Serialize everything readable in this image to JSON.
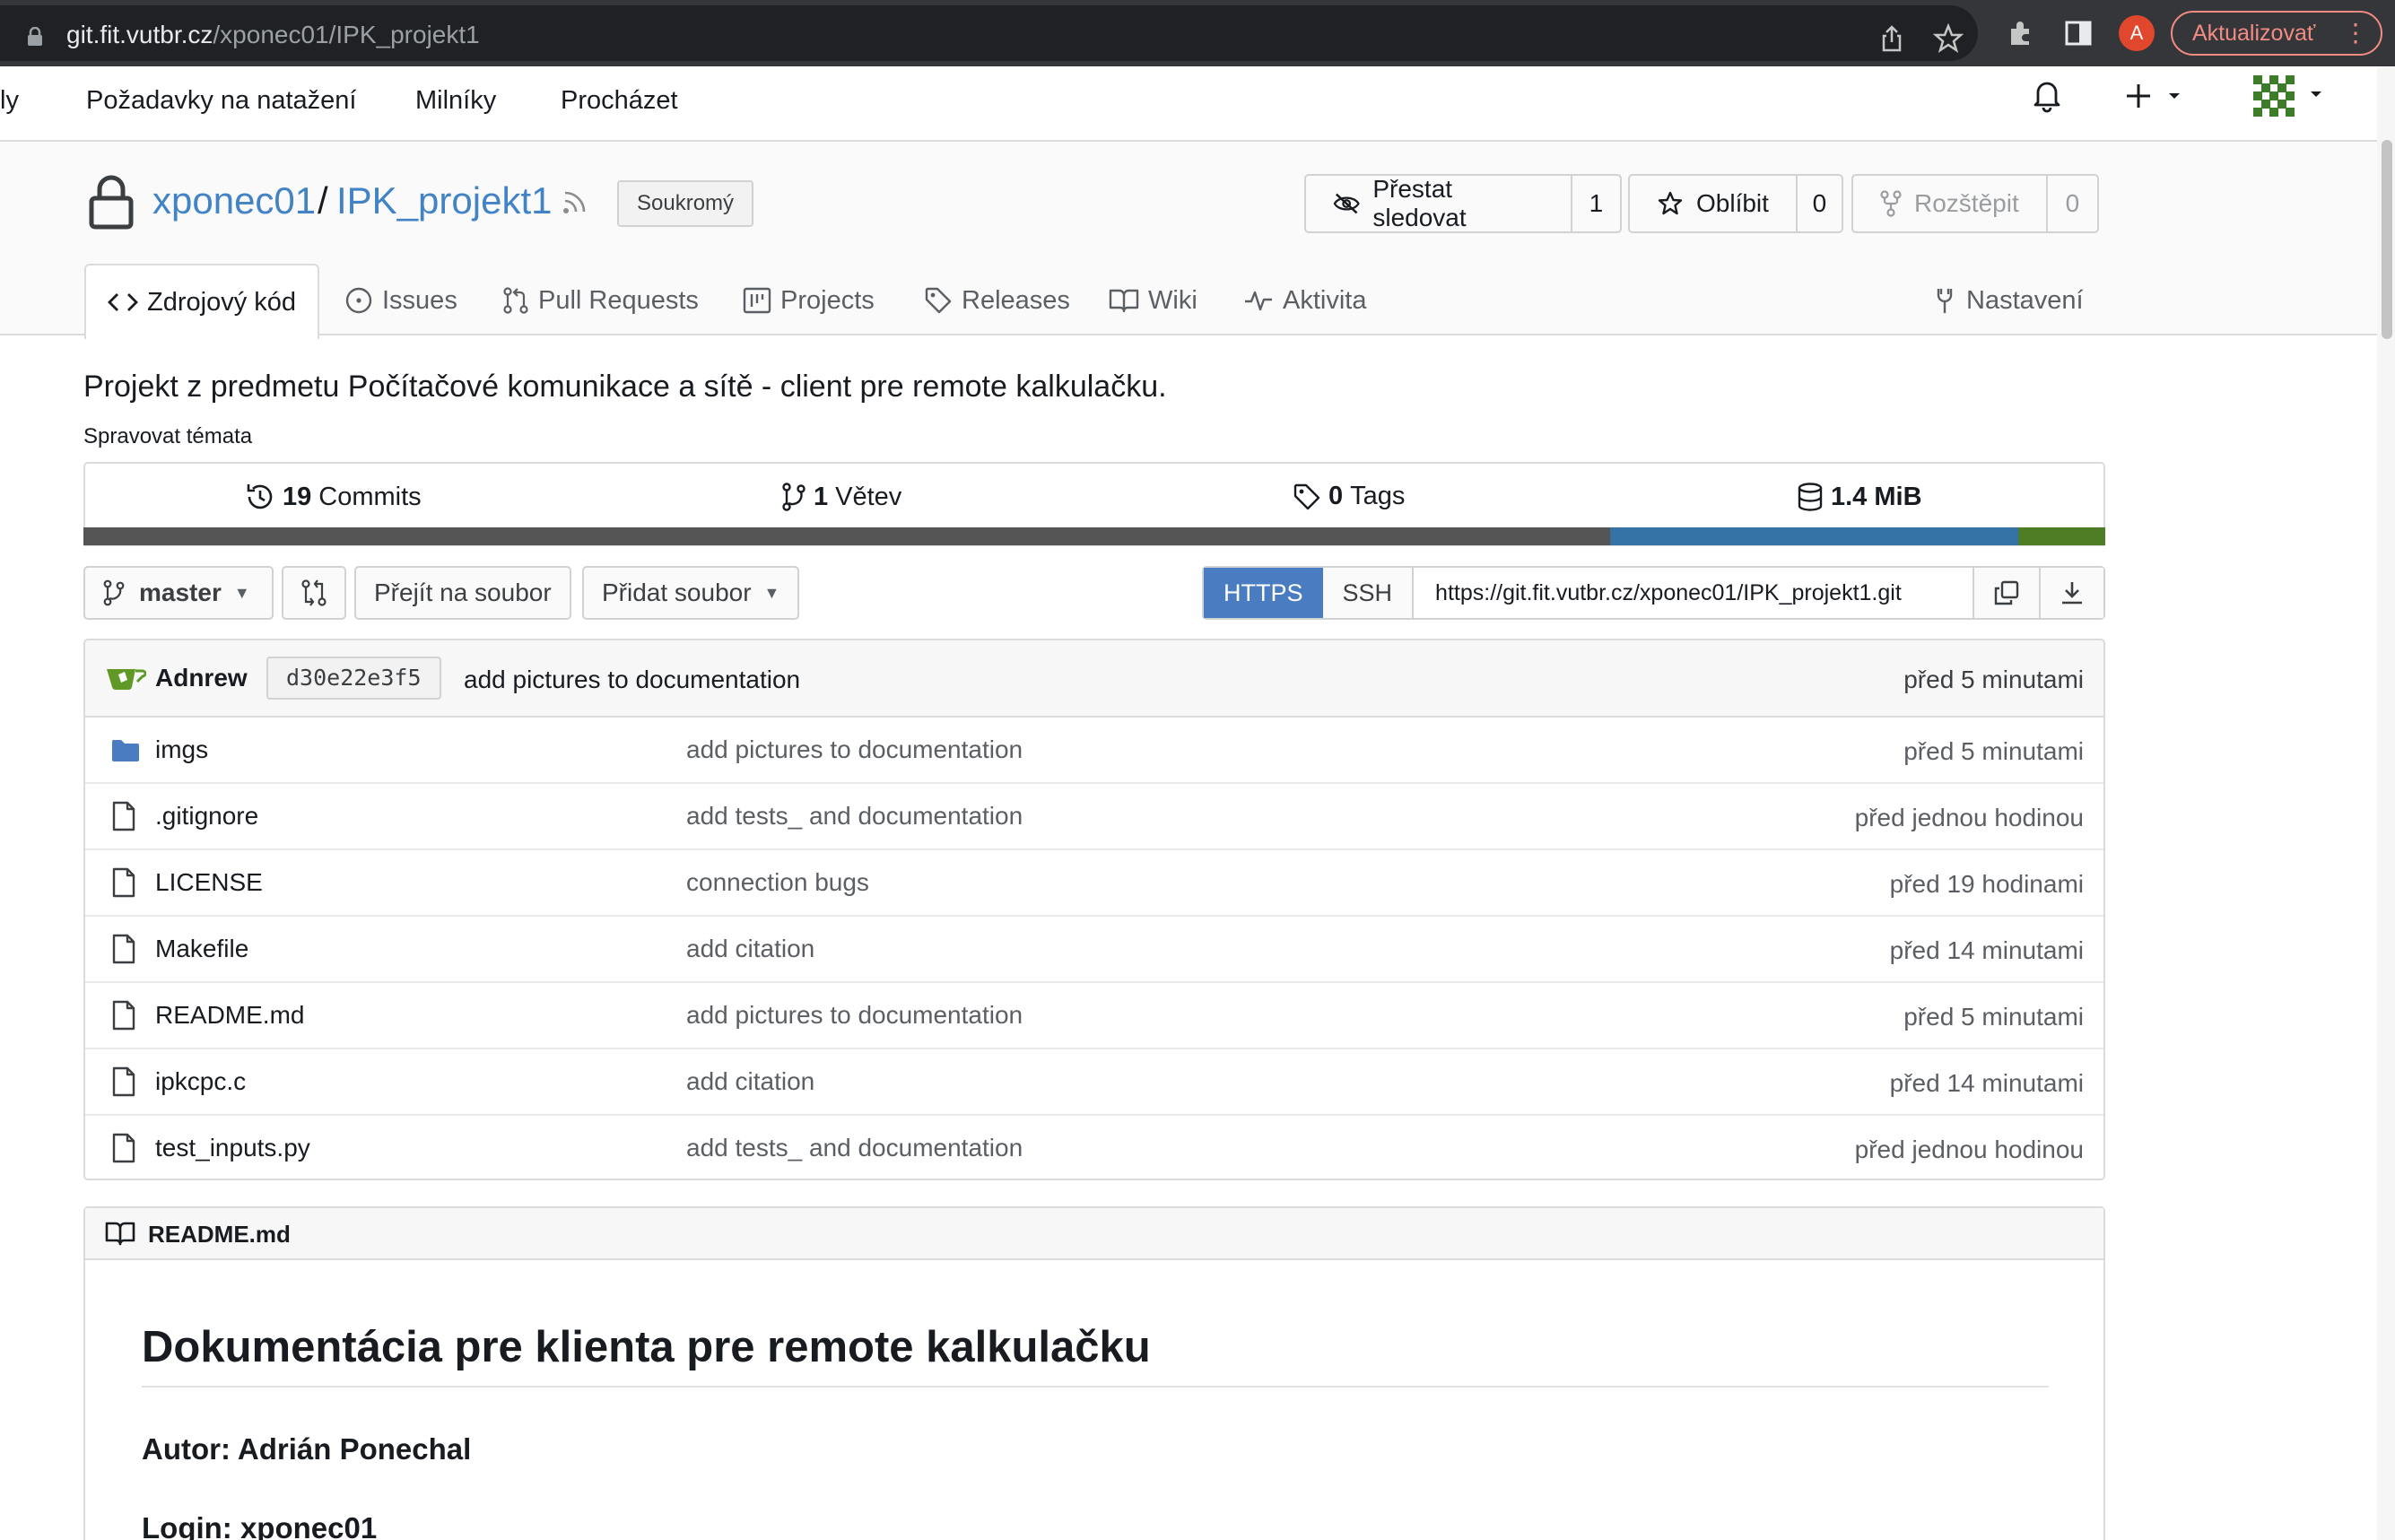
{
  "browser": {
    "url_host": "git.fit.vutbr.cz",
    "url_path": "/xponec01/IPK_projekt1",
    "avatar_letter": "A",
    "update_label": "Aktualizovať"
  },
  "topnav": {
    "items": [
      "ly",
      "Požadavky na natažení",
      "Milníky",
      "Procházet"
    ]
  },
  "repo": {
    "owner": "xponec01",
    "separator": "/",
    "name": "IPK_projekt1",
    "visibility": "Soukromý",
    "watch_label": "Přestat sledovat",
    "watch_count": "1",
    "star_label": "Oblíbit",
    "star_count": "0",
    "fork_label": "Rozštěpit",
    "fork_count": "0"
  },
  "tabs": [
    {
      "label": "Zdrojový kód",
      "icon": "code-icon"
    },
    {
      "label": "Issues",
      "icon": "issue-icon"
    },
    {
      "label": "Pull Requests",
      "icon": "pull-request-icon"
    },
    {
      "label": "Projects",
      "icon": "project-icon"
    },
    {
      "label": "Releases",
      "icon": "tag-icon"
    },
    {
      "label": "Wiki",
      "icon": "book-icon"
    },
    {
      "label": "Aktivita",
      "icon": "pulse-icon"
    },
    {
      "label": "Nastavení",
      "icon": "tools-icon"
    }
  ],
  "description": "Projekt z predmetu Počítačové komunikace a sítě - client pre remote kalkulačku.",
  "manage_topics": "Spravovat témata",
  "stats": {
    "commits_count": "19",
    "commits_label": "Commits",
    "branches_count": "1",
    "branches_label": "Větev",
    "tags_count": "0",
    "tags_label": "Tags",
    "size": "1.4 MiB"
  },
  "languages": [
    {
      "fraction": 0.755,
      "color": "#555555"
    },
    {
      "fraction": 0.202,
      "color": "#3572a5"
    },
    {
      "fraction": 0.043,
      "color": "#4e7d26"
    }
  ],
  "toolbar": {
    "branch": "master",
    "go_to_file": "Přejít na soubor",
    "add_file": "Přidat soubor"
  },
  "clone": {
    "https": "HTTPS",
    "ssh": "SSH",
    "url": "https://git.fit.vutbr.cz/xponec01/IPK_projekt1.git"
  },
  "latest_commit": {
    "author": "Adnrew",
    "sha": "d30e22e3f5",
    "message": "add pictures to documentation",
    "time": "před 5 minutami"
  },
  "files": [
    {
      "name": "imgs",
      "type": "folder",
      "message": "add pictures to documentation",
      "time": "před 5 minutami"
    },
    {
      "name": ".gitignore",
      "type": "file",
      "message": "add tests_ and documentation",
      "time": "před jednou hodinou"
    },
    {
      "name": "LICENSE",
      "type": "file",
      "message": "connection bugs",
      "time": "před 19 hodinami"
    },
    {
      "name": "Makefile",
      "type": "file",
      "message": "add citation",
      "time": "před 14 minutami"
    },
    {
      "name": "README.md",
      "type": "file",
      "message": "add pictures to documentation",
      "time": "před 5 minutami"
    },
    {
      "name": "ipkcpc.c",
      "type": "file",
      "message": "add citation",
      "time": "před 14 minutami"
    },
    {
      "name": "test_inputs.py",
      "type": "file",
      "message": "add tests_ and documentation",
      "time": "před jednou hodinou"
    }
  ],
  "readme": {
    "filename": "README.md",
    "heading": "Dokumentácia pre klienta pre remote kalkulačku",
    "author_line": "Autor: Adrián Ponechal",
    "login_line": "Login: xponec01"
  },
  "colors": {
    "link": "#4183c4",
    "https_active": "#4a7cc1",
    "folder": "#4a7cc1"
  }
}
